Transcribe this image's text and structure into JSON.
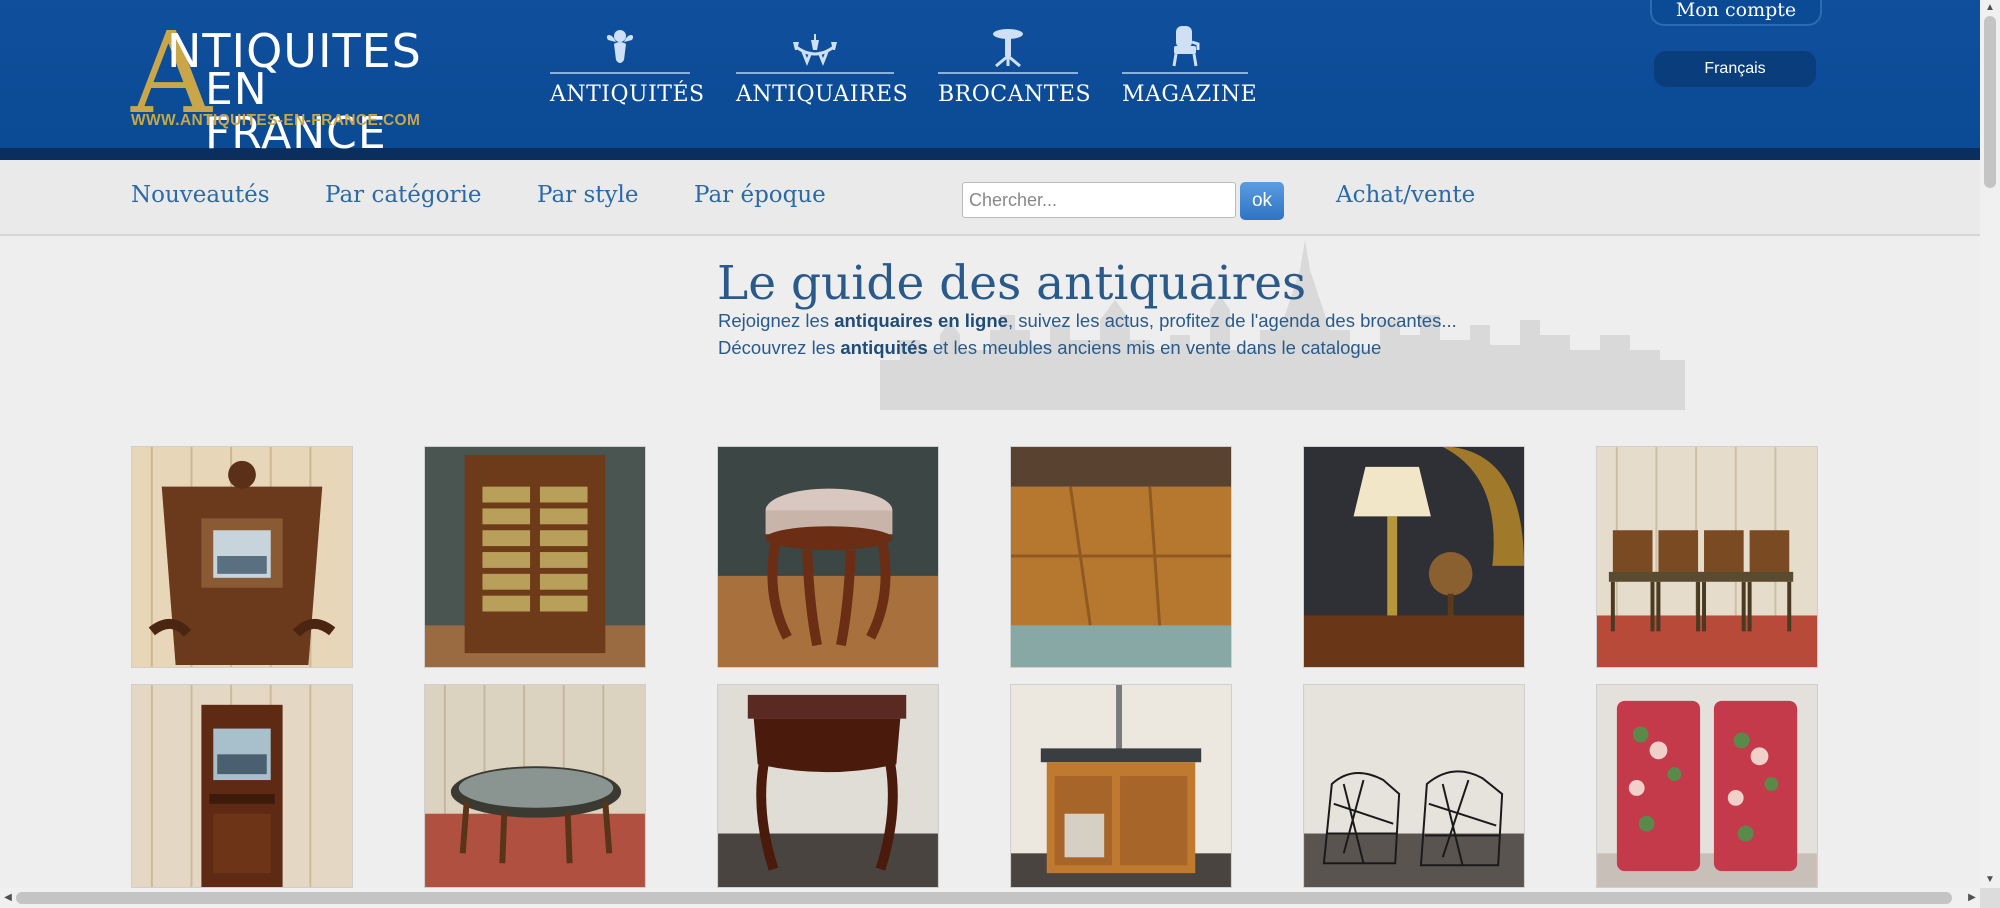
{
  "brand": {
    "logo_letter": "A",
    "logo_line1": "NTIQUITES",
    "logo_line2": "EN FRANCE",
    "url": "WWW.ANTIQUITES-EN-FRANCE.COM"
  },
  "colors": {
    "header_blue": "#0b4a94",
    "header_dark": "#0a2f5e",
    "gold": "#c9a64a",
    "link_blue": "#2a6aa8"
  },
  "main_nav": [
    {
      "label": "ANTIQUITÉS",
      "icon": "cherub-icon"
    },
    {
      "label": "ANTIQUAIRES",
      "icon": "chandelier-icon"
    },
    {
      "label": "BROCANTES",
      "icon": "pedestal-table-icon"
    },
    {
      "label": "MAGAZINE",
      "icon": "armchair-icon"
    }
  ],
  "account": {
    "label": "Mon compte"
  },
  "language": {
    "label": "Français"
  },
  "sub_nav": {
    "items": [
      "Nouveautés",
      "Par catégorie",
      "Par style",
      "Par époque"
    ],
    "search_placeholder": "Chercher...",
    "ok_label": "ok",
    "achat_vente": "Achat/vente"
  },
  "intro": {
    "title": "Le guide des antiquaires",
    "p1_pre": "Rejoignez les ",
    "p1_bold": "antiquaires en ligne",
    "p1_post": ", suivez les actus, profitez de l'agenda des brocantes...",
    "p2_pre": "Découvrez les ",
    "p2_bold": "antiquités",
    "p2_post": " et les meubles anciens mis en vente dans le catalogue"
  },
  "products": [
    {
      "name": "carved-wall-cabinet-photo"
    },
    {
      "name": "chest-of-drawers-photo"
    },
    {
      "name": "round-stool-photo"
    },
    {
      "name": "wooden-table-top-photo"
    },
    {
      "name": "table-lamp-and-globe-photo"
    },
    {
      "name": "set-of-chairs-photo"
    },
    {
      "name": "hall-stand-photo"
    },
    {
      "name": "oval-coffee-table-photo"
    },
    {
      "name": "marble-console-photo"
    },
    {
      "name": "washstand-cabinet-photo"
    },
    {
      "name": "wire-armchairs-photo"
    },
    {
      "name": "floral-armchairs-photo"
    }
  ]
}
